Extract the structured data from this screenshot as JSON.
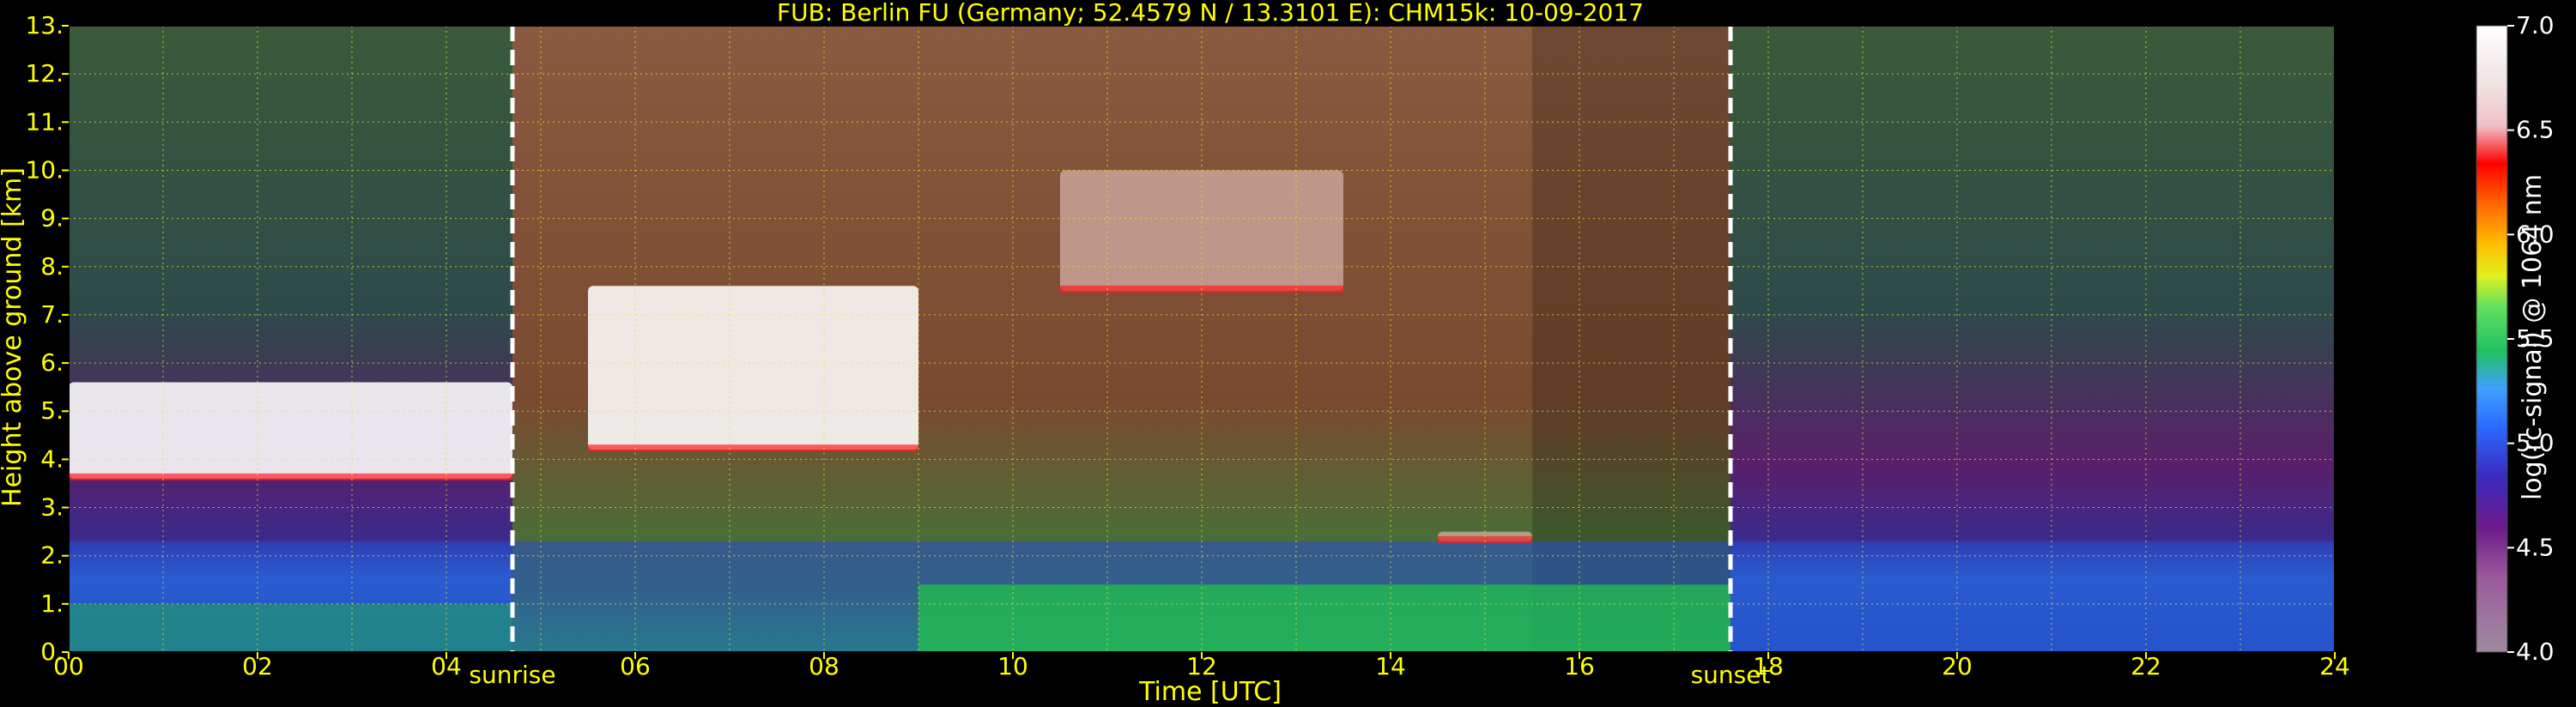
{
  "chart_data": {
    "type": "heatmap",
    "title": "FUB: Berlin FU (Germany; 52.4579 N / 13.3101 E):     CHM15k: 10-09-2017",
    "xlabel": "Time [UTC]",
    "ylabel": "Height above ground [km]",
    "xlim": [
      0,
      24
    ],
    "ylim": [
      0,
      13
    ],
    "x_ticks": [
      "00",
      "02",
      "04",
      "06",
      "08",
      "10",
      "12",
      "14",
      "16",
      "18",
      "20",
      "22",
      "24"
    ],
    "y_ticks": [
      "0.",
      "1.",
      "2.",
      "3.",
      "4.",
      "5.",
      "6.",
      "7.",
      "8.",
      "9.",
      "10.",
      "11.",
      "12.",
      "13."
    ],
    "grid": true,
    "markers": [
      {
        "label": "sunrise",
        "time": 4.7
      },
      {
        "label": "sunset",
        "time": 17.6
      }
    ],
    "colorbar": {
      "label": "log(rc-signal) @ 1064 nm",
      "range": [
        4.0,
        7.0
      ],
      "ticks": [
        "4.0",
        "4.5",
        "5.0",
        "5.5",
        "6.0",
        "6.5",
        "7.0"
      ]
    },
    "features": [
      {
        "name": "cloud layer",
        "t_start": 0.0,
        "t_end": 4.7,
        "h_bottom": 3.6,
        "h_top": 5.6
      },
      {
        "name": "cloud layer",
        "t_start": 5.5,
        "t_end": 9.0,
        "h_bottom": 4.2,
        "h_top": 7.6
      },
      {
        "name": "cirrus",
        "t_start": 10.5,
        "t_end": 13.5,
        "h_bottom": 7.5,
        "h_top": 10.0
      },
      {
        "name": "boundary layer top",
        "t_start": 14.5,
        "t_end": 15.5,
        "h_bottom": 2.3,
        "h_top": 2.5
      }
    ]
  }
}
